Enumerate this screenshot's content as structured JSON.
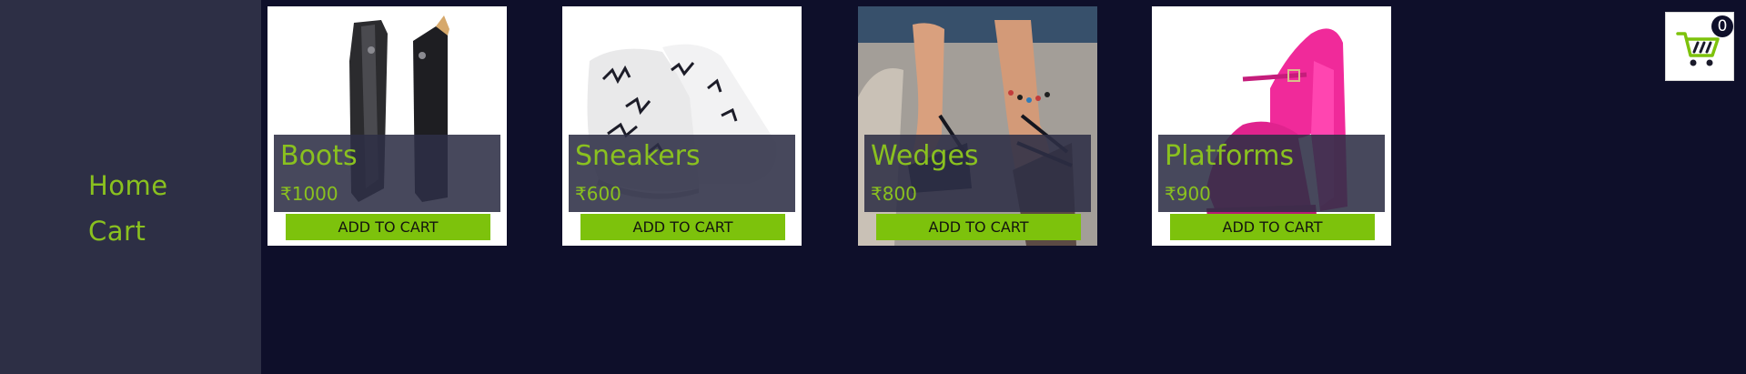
{
  "nav": {
    "items": [
      {
        "label": "Home"
      },
      {
        "label": "Cart"
      }
    ]
  },
  "products": [
    {
      "name": "Boots",
      "price": "₹1000",
      "button": "ADD TO CART",
      "image": "black-riding-boots"
    },
    {
      "name": "Sneakers",
      "price": "₹600",
      "button": "ADD TO CART",
      "image": "white-printed-sneakers"
    },
    {
      "name": "Wedges",
      "price": "₹800",
      "button": "ADD TO CART",
      "image": "strappy-wedge-sandals"
    },
    {
      "name": "Platforms",
      "price": "₹900",
      "button": "ADD TO CART",
      "image": "pink-platform-heels"
    }
  ],
  "cart": {
    "count": "0",
    "icon": "shopping-cart-icon"
  },
  "colors": {
    "background": "#0e0f2a",
    "sidebar": "#2d2f45",
    "accent": "#8ac11f",
    "button": "#7dc20c"
  }
}
